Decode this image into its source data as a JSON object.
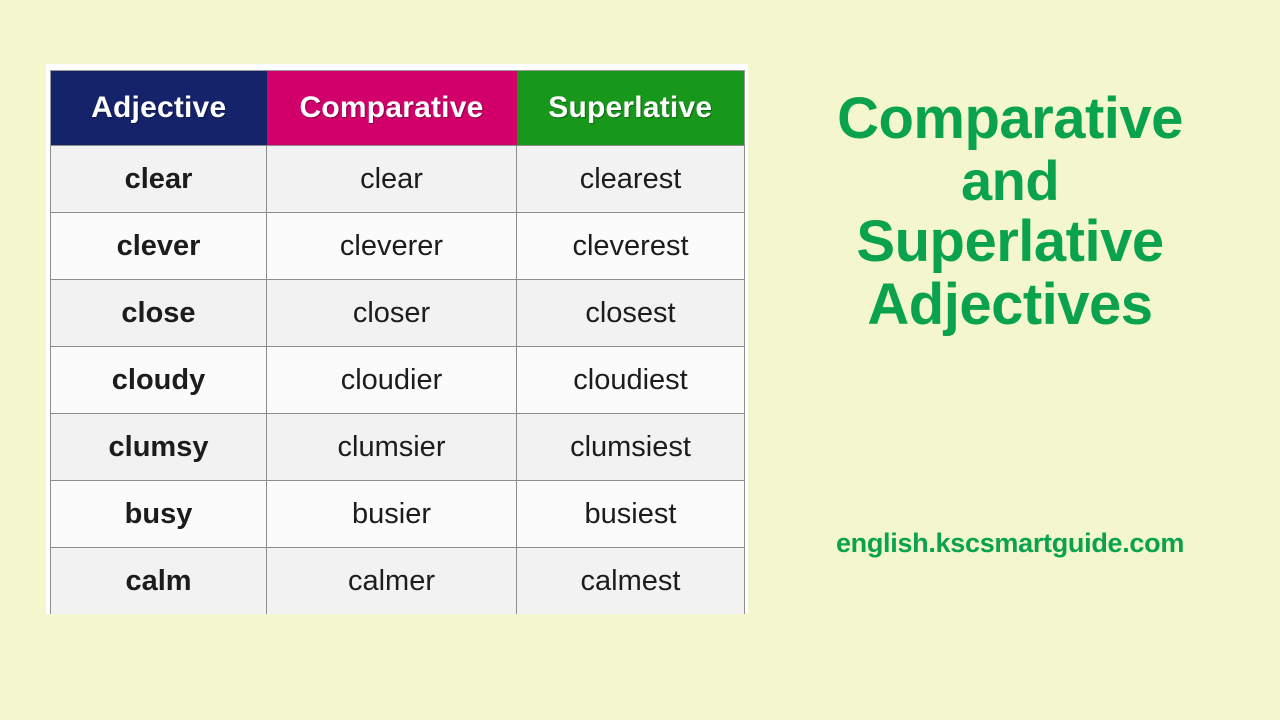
{
  "background_color": "#f4f7cd",
  "table": {
    "frame_color": "#ffffff",
    "headers": [
      {
        "label": "Adjective",
        "color": "#15236b"
      },
      {
        "label": "Comparative",
        "color": "#d1006a"
      },
      {
        "label": "Superlative",
        "color": "#17981b"
      }
    ],
    "rows": [
      {
        "adjective": "clear",
        "comparative": "clear",
        "superlative": "clearest"
      },
      {
        "adjective": "clever",
        "comparative": "cleverer",
        "superlative": "cleverest"
      },
      {
        "adjective": "close",
        "comparative": "closer",
        "superlative": "closest"
      },
      {
        "adjective": "cloudy",
        "comparative": "cloudier",
        "superlative": "cloudiest"
      },
      {
        "adjective": "clumsy",
        "comparative": "clumsier",
        "superlative": "clumsiest"
      },
      {
        "adjective": "busy",
        "comparative": "busier",
        "superlative": "busiest"
      },
      {
        "adjective": "calm",
        "comparative": "calmer",
        "superlative": "calmest"
      }
    ]
  },
  "title": {
    "color": "#0aa24c",
    "lines": [
      "Comparative",
      "and",
      "Superlative",
      "Adjectives"
    ]
  },
  "footer": {
    "url": "english.kscsmartguide.com",
    "color": "#0aa24c"
  }
}
